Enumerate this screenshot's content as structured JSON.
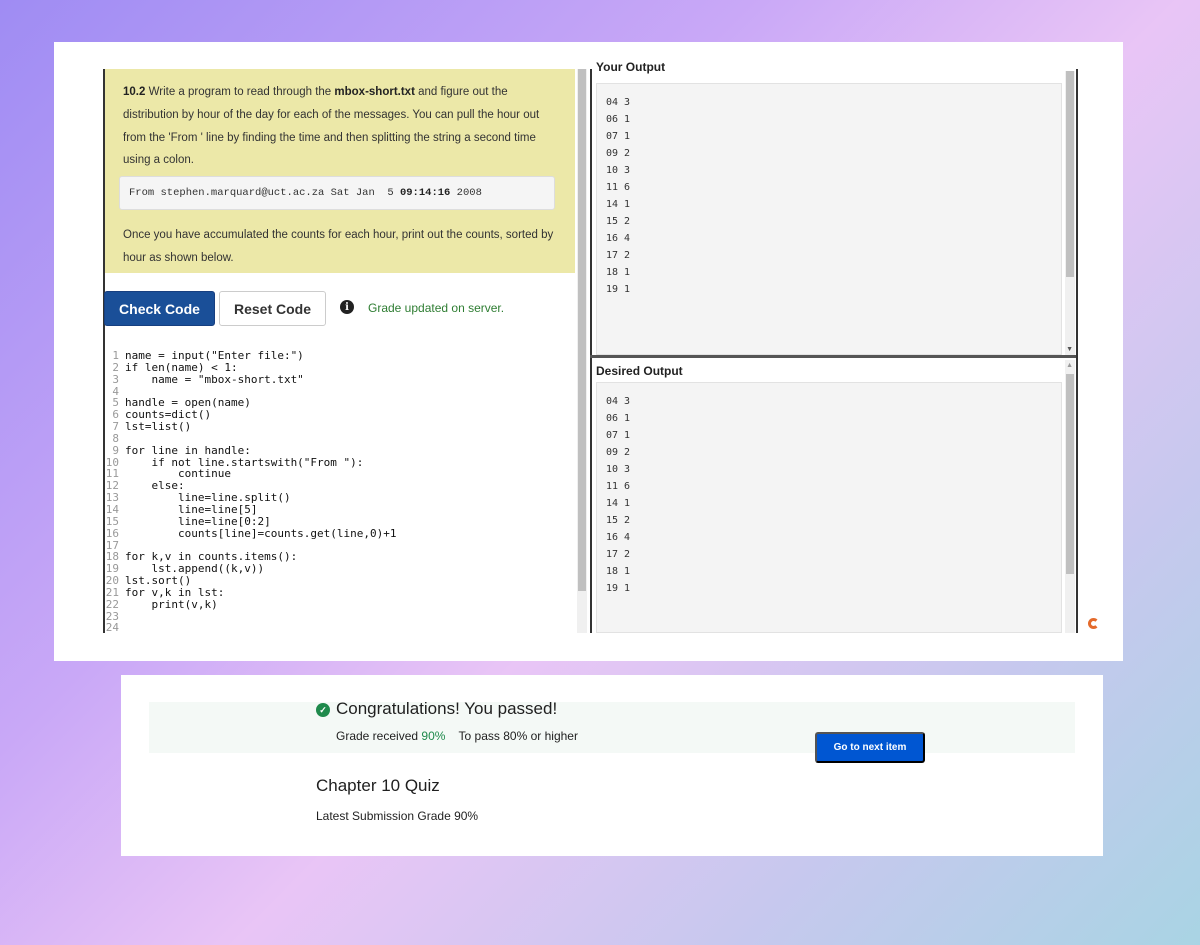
{
  "problem": {
    "number": "10.2",
    "text_1": "Write a program to read through the",
    "file_name": "mbox-short.txt",
    "text_2": "and figure out the distribution by hour of the day for each of the messages. You can pull the hour out from the 'From ' line by finding the time and then splitting the string a second time using a colon.",
    "sample_pre": "From stephen.marquard@uct.ac.za Sat Jan  5 ",
    "sample_time": "09:14:16",
    "sample_post": " 2008",
    "text_3": "Once you have accumulated the counts for each hour, print out the counts, sorted by hour as shown below."
  },
  "toolbar": {
    "check_label": "Check Code",
    "reset_label": "Reset Code",
    "info_glyph": "i",
    "status": "Grade updated on server."
  },
  "code_lines": [
    {
      "n": "1",
      "t": "name = input(\"Enter file:\")"
    },
    {
      "n": "2",
      "t": "if len(name) < 1:"
    },
    {
      "n": "3",
      "t": "    name = \"mbox-short.txt\""
    },
    {
      "n": "4",
      "t": ""
    },
    {
      "n": "5",
      "t": "handle = open(name)"
    },
    {
      "n": "6",
      "t": "counts=dict()"
    },
    {
      "n": "7",
      "t": "lst=list()"
    },
    {
      "n": "8",
      "t": ""
    },
    {
      "n": "9",
      "t": "for line in handle:"
    },
    {
      "n": "10",
      "t": "    if not line.startswith(\"From \"):"
    },
    {
      "n": "11",
      "t": "        continue"
    },
    {
      "n": "12",
      "t": "    else:"
    },
    {
      "n": "13",
      "t": "        line=line.split()"
    },
    {
      "n": "14",
      "t": "        line=line[5]"
    },
    {
      "n": "15",
      "t": "        line=line[0:2]"
    },
    {
      "n": "16",
      "t": "        counts[line]=counts.get(line,0)+1"
    },
    {
      "n": "17",
      "t": ""
    },
    {
      "n": "18",
      "t": "for k,v in counts.items():"
    },
    {
      "n": "19",
      "t": "    lst.append((k,v))"
    },
    {
      "n": "20",
      "t": "lst.sort()"
    },
    {
      "n": "21",
      "t": "for v,k in lst:"
    },
    {
      "n": "22",
      "t": "    print(v,k)"
    },
    {
      "n": "23",
      "t": ""
    },
    {
      "n": "24",
      "t": ""
    }
  ],
  "your_output": {
    "title": "Your Output",
    "lines": [
      "04 3",
      "06 1",
      "07 1",
      "09 2",
      "10 3",
      "11 6",
      "14 1",
      "15 2",
      "16 4",
      "17 2",
      "18 1",
      "19 1"
    ]
  },
  "desired_output": {
    "title": "Desired Output",
    "lines": [
      "04 3",
      "06 1",
      "07 1",
      "09 2",
      "10 3",
      "11 6",
      "14 1",
      "15 2",
      "16 4",
      "17 2",
      "18 1",
      "19 1"
    ]
  },
  "result": {
    "check_glyph": "✓",
    "title": "Congratulations! You passed!",
    "grade_label": "Grade received",
    "grade_value": "90%",
    "pass_label": "To pass",
    "pass_value": "80% or higher",
    "next_label": "Go to next item"
  },
  "quiz": {
    "title": "Chapter 10 Quiz",
    "latest": "Latest Submission Grade 90%"
  },
  "colors": {
    "primary_button": "#1a4f98",
    "next_button": "#0056d2",
    "problem_bg": "#ece8a8",
    "success_green": "#1f8a4c"
  }
}
